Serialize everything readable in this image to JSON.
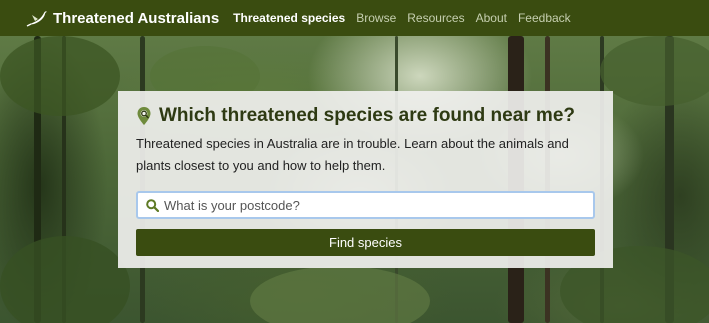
{
  "navbar": {
    "brand": "Threatened Australians",
    "links": [
      {
        "label": "Threatened species",
        "active": true
      },
      {
        "label": "Browse",
        "active": false
      },
      {
        "label": "Resources",
        "active": false
      },
      {
        "label": "About",
        "active": false
      },
      {
        "label": "Feedback",
        "active": false
      }
    ]
  },
  "hero": {
    "title": "Which threatened species are found near me?",
    "description": "Threatened species in Australia are in trouble. Learn about the animals and plants closest to you and how to help them.",
    "search": {
      "placeholder": "What is your postcode?",
      "value": ""
    },
    "button_label": "Find species"
  },
  "colors": {
    "brand_green": "#3a4c10",
    "title_green": "#2e3a13",
    "focus_blue": "#a8c8ec"
  },
  "icons": {
    "brand": "bird-icon",
    "title": "map-search-icon",
    "search": "search-icon"
  }
}
